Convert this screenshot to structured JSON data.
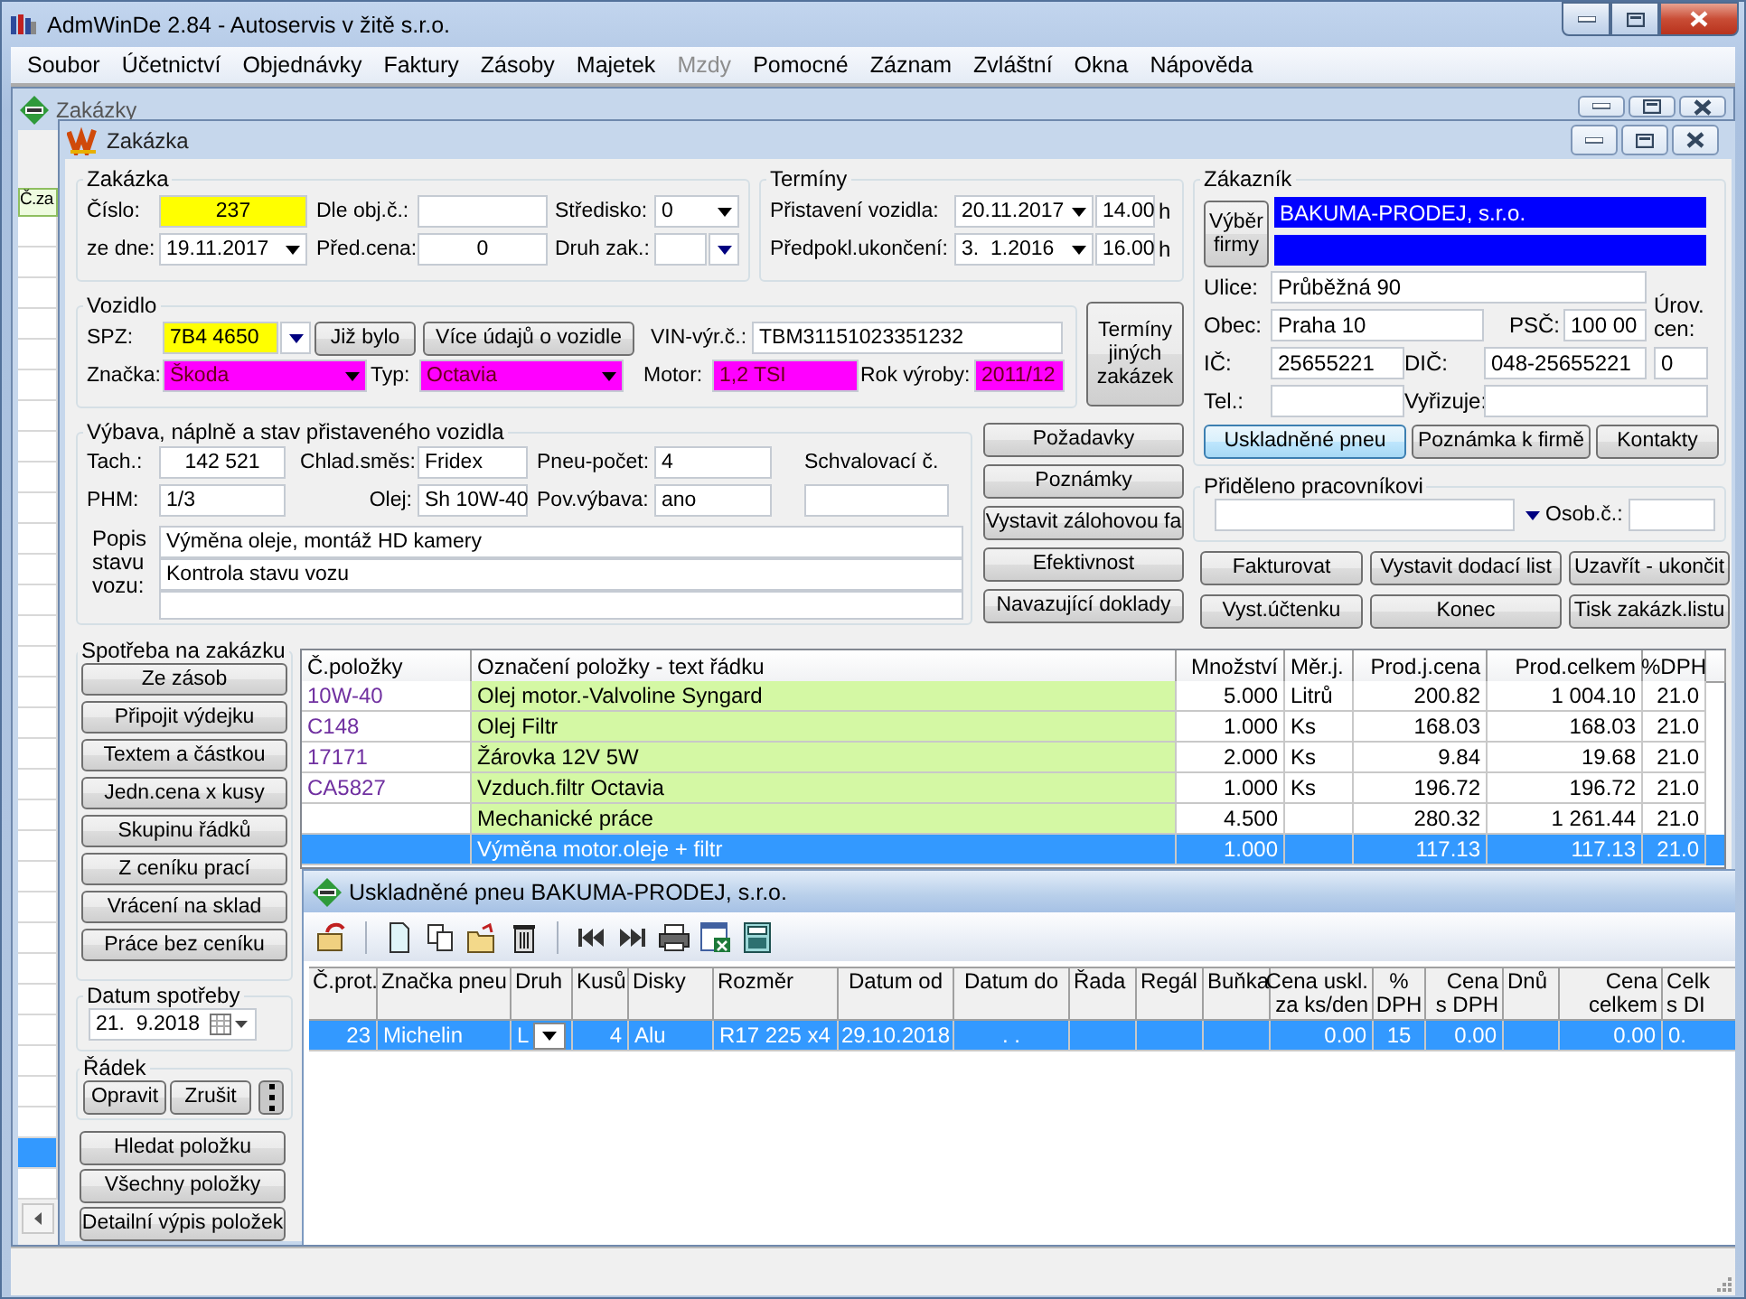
{
  "app": {
    "title": "AdmWinDe 2.84 - Autoservis v žitě s.r.o."
  },
  "menu": [
    {
      "label": "Soubor",
      "disabled": false
    },
    {
      "label": "Účetnictví",
      "disabled": false
    },
    {
      "label": "Objednávky",
      "disabled": false
    },
    {
      "label": "Faktury",
      "disabled": false
    },
    {
      "label": "Zásoby",
      "disabled": false
    },
    {
      "label": "Majetek",
      "disabled": false
    },
    {
      "label": "Mzdy",
      "disabled": true
    },
    {
      "label": "Pomocné",
      "disabled": false
    },
    {
      "label": "Záznam",
      "disabled": false
    },
    {
      "label": "Zvláštní",
      "disabled": false
    },
    {
      "label": "Okna",
      "disabled": false
    },
    {
      "label": "Nápověda",
      "disabled": false
    }
  ],
  "orders_window": {
    "title": "Zakázky",
    "column_1": "Č.za",
    "rows": [
      {
        "selected": false
      },
      {
        "selected": false
      },
      {
        "selected": false
      },
      {
        "selected": false
      },
      {
        "selected": false
      },
      {
        "selected": false
      },
      {
        "selected": false
      },
      {
        "selected": false
      },
      {
        "selected": false
      },
      {
        "selected": false
      },
      {
        "selected": false
      },
      {
        "selected": false
      },
      {
        "selected": false
      },
      {
        "selected": false
      },
      {
        "selected": false
      },
      {
        "selected": false
      },
      {
        "selected": false
      },
      {
        "selected": false
      },
      {
        "selected": false
      },
      {
        "selected": false
      },
      {
        "selected": false
      },
      {
        "selected": false
      },
      {
        "selected": false
      },
      {
        "selected": false
      },
      {
        "selected": false
      },
      {
        "selected": false
      },
      {
        "selected": false
      },
      {
        "selected": false
      },
      {
        "selected": false
      },
      {
        "selected": false
      },
      {
        "selected": true
      },
      {
        "selected": false
      }
    ]
  },
  "order_window": {
    "title": "Zakázka",
    "order": {
      "legend": "Zakázka",
      "fields": [
        {
          "label": "Číslo:",
          "value": "237",
          "kind": "number",
          "color": "#ffff00"
        },
        {
          "label": "Dle obj.č.:",
          "kind": "text"
        },
        {
          "label": "Středisko:",
          "value": "0",
          "kind": "dropdown"
        },
        {
          "label": "ze dne:",
          "value": "19.11.2017",
          "kind": "date"
        },
        {
          "label": "Před.cena:",
          "value": "0",
          "kind": "number"
        },
        {
          "label": "Druh zak.:",
          "kind": "combo"
        }
      ]
    },
    "terms": {
      "legend": "Termíny",
      "fields": [
        {
          "label": "Přistavení vozidla:",
          "value": "20.11.2017",
          "kind": "date"
        },
        {
          "value": "14.00",
          "kind": "text",
          "unit": "h"
        },
        {
          "label": "Předpokl.ukončení:",
          "value": "3.  1.2016",
          "kind": "date"
        },
        {
          "value": "16.00",
          "kind": "text",
          "unit": "h"
        }
      ]
    },
    "customer": {
      "legend": "Zákazník",
      "select_button": "Výběr firmy",
      "company": "BAKUMA-PRODEJ, s.r.o.",
      "fields": [
        {
          "label": "Ulice:",
          "value": "Průběžná 90",
          "kind": "text"
        },
        {
          "label": "Obec:",
          "value": "Praha 10",
          "kind": "text"
        },
        {
          "label": "PSČ:",
          "value": "100 00",
          "kind": "text"
        },
        {
          "label": "IČ:",
          "value": "25655221",
          "kind": "text"
        },
        {
          "label": "DIČ:",
          "value": "048-25655221",
          "kind": "text"
        },
        {
          "label": "Úrov. cen:",
          "value": "0",
          "kind": "text"
        },
        {
          "label": "Tel.:",
          "kind": "text"
        },
        {
          "label": "Vyřizuje:",
          "kind": "text"
        }
      ],
      "buttons": [
        {
          "label": "Uskladněné pneu",
          "focused": true
        },
        {
          "label": "Poznámka k firmě",
          "focused": false
        },
        {
          "label": "Kontakty",
          "focused": false
        }
      ]
    },
    "vehicle": {
      "legend": "Vozidlo",
      "fields": [
        {
          "label": "SPZ:",
          "value": "7B4 4650",
          "kind": "combo",
          "color": "#ffff00"
        },
        {
          "label": "Již bylo",
          "kind": "button"
        },
        {
          "label": "Více údajů o vozidle",
          "kind": "button"
        },
        {
          "label": "VIN-výr.č.:",
          "value": "TBM31151023351232",
          "kind": "text"
        },
        {
          "label": "Značka:",
          "value": "Škoda",
          "kind": "dropdown",
          "color": "#ff00ff"
        },
        {
          "label": "Typ:",
          "value": "Octavia",
          "kind": "dropdown",
          "color": "#ff00ff"
        },
        {
          "label": "Motor:",
          "value": "1,2 TSI",
          "kind": "text",
          "color": "#ff00ff"
        },
        {
          "label": "Rok výroby:",
          "value": "2011/12",
          "kind": "text",
          "color": "#ff00ff"
        }
      ]
    },
    "other_terms_button": "Termíny jiných zakázek",
    "equipment": {
      "legend": "Výbava, náplně a stav přistaveného vozidla",
      "fields": [
        {
          "label": "Tach.:",
          "value": "142 521",
          "kind": "number"
        },
        {
          "label": "Chlad.směs:",
          "value": "Fridex",
          "kind": "text"
        },
        {
          "label": "Pneu-počet:",
          "value": "4",
          "kind": "text"
        },
        {
          "label": "Schvalovací č.",
          "kind": "text"
        },
        {
          "label": "PHM:",
          "value": "1/3",
          "kind": "text"
        },
        {
          "label": "Olej:",
          "value": "Sh 10W-40",
          "kind": "text"
        },
        {
          "label": "Pov.výbava:",
          "value": "ano",
          "kind": "text"
        }
      ],
      "description": {
        "label": "Popis stavu vozu:",
        "lines": [
          "Výměna oleje, montáž HD kamery",
          "Kontrola stavu vozu"
        ]
      }
    },
    "side_buttons": [
      "Požadavky",
      "Poznámky",
      "Vystavit zálohovou fa",
      "Efektivnost",
      "Navazující doklady"
    ],
    "assigned": {
      "legend": "Přiděleno pracovníkovi",
      "personal_number_label": "Osob.č.:"
    },
    "action_buttons": [
      "Fakturovat",
      "Vystavit dodací list",
      "Uzavřít - ukončit",
      "Vyst.účtenku",
      "Konec",
      "Tisk zakázk.listu"
    ],
    "consumption": {
      "legend": "Spotřeba na zakázku",
      "buttons": [
        "Ze zásob",
        "Připojit výdejku",
        "Textem a částkou",
        "Jedn.cena x kusy",
        "Skupinu řádků",
        "Z ceníku prací",
        "Vrácení na sklad",
        "Práce bez ceníku"
      ]
    },
    "consumption_date": {
      "legend": "Datum spotřeby",
      "value": "21.  9.2018"
    },
    "line": {
      "legend": "Řádek",
      "buttons": [
        "Opravit",
        "Zrušit"
      ]
    },
    "bottom_buttons": [
      "Hledat položku",
      "Všechny položky",
      "Detailní výpis položek"
    ],
    "items": {
      "columns": [
        {
          "label": "Č.položky",
          "kind": "code"
        },
        {
          "label": "Označení položky - text řádku",
          "kind": "highlight"
        },
        {
          "label": "Množství",
          "kind": "number"
        },
        {
          "label": "Měr.j.",
          "kind": "text"
        },
        {
          "label": "Prod.j.cena",
          "kind": "number"
        },
        {
          "label": "Prod.celkem",
          "kind": "number"
        },
        {
          "label": "%DPH",
          "kind": "number"
        }
      ],
      "rows": [
        {
          "selected": false,
          "cells": [
            "10W-40",
            "Olej motor.-Valvoline Syngard",
            "5.000",
            "Litrů",
            "200.82",
            "1 004.10",
            "21.0"
          ]
        },
        {
          "selected": false,
          "cells": [
            "C148",
            "Olej Filtr",
            "1.000",
            "Ks",
            "168.03",
            "168.03",
            "21.0"
          ]
        },
        {
          "selected": false,
          "cells": [
            "17171",
            "Žárovka 12V 5W",
            "2.000",
            "Ks",
            "9.84",
            "19.68",
            "21.0"
          ]
        },
        {
          "selected": false,
          "cells": [
            "CA5827",
            "Vzduch.filtr Octavia",
            "1.000",
            "Ks",
            "196.72",
            "196.72",
            "21.0"
          ]
        },
        {
          "selected": false,
          "cells": [
            null,
            "Mechanické práce",
            "4.500",
            null,
            "280.32",
            "1 261.44",
            "21.0"
          ]
        },
        {
          "selected": true,
          "cells": [
            null,
            "Výměna motor.oleje + filtr",
            "1.000",
            null,
            "117.13",
            "117.13",
            "21.0"
          ]
        }
      ]
    }
  },
  "tire_window": {
    "title": "Uskladněné pneu BAKUMA-PRODEJ, s.r.o.",
    "columns": [
      {
        "lines": [
          "Č.prot."
        ],
        "kind": "number"
      },
      {
        "lines": [
          "Značka pneu"
        ],
        "kind": "text"
      },
      {
        "lines": [
          "Druh"
        ],
        "kind": "dropdown"
      },
      {
        "lines": [
          "Kusů"
        ],
        "kind": "number"
      },
      {
        "lines": [
          "Disky"
        ],
        "kind": "text"
      },
      {
        "lines": [
          "Rozměr"
        ],
        "kind": "text"
      },
      {
        "lines": [
          "Datum od"
        ],
        "kind": "center"
      },
      {
        "lines": [
          "Datum do"
        ],
        "kind": "center"
      },
      {
        "lines": [
          "Řada"
        ],
        "kind": "text"
      },
      {
        "lines": [
          "Regál"
        ],
        "kind": "text"
      },
      {
        "lines": [
          "Buňka"
        ],
        "kind": "text"
      },
      {
        "lines": [
          "Cena uskl.",
          "za ks/den"
        ],
        "kind": "number"
      },
      {
        "lines": [
          "%",
          "DPH"
        ],
        "kind": "center"
      },
      {
        "lines": [
          "Cena",
          "s DPH"
        ],
        "kind": "number"
      },
      {
        "lines": [
          "Dnů"
        ],
        "kind": "text"
      },
      {
        "lines": [
          "Cena",
          "celkem"
        ],
        "kind": "number"
      },
      {
        "lines": [
          "Celk",
          "s DI"
        ],
        "kind": "text"
      }
    ],
    "rows": [
      {
        "selected": true,
        "cells": [
          "23",
          "Michelin",
          "L",
          "4",
          "Alu",
          "R17 225 x4",
          "29.10.2018",
          ". .",
          null,
          null,
          null,
          "0.00",
          "15",
          "0.00",
          null,
          "0.00",
          "0."
        ]
      }
    ]
  }
}
